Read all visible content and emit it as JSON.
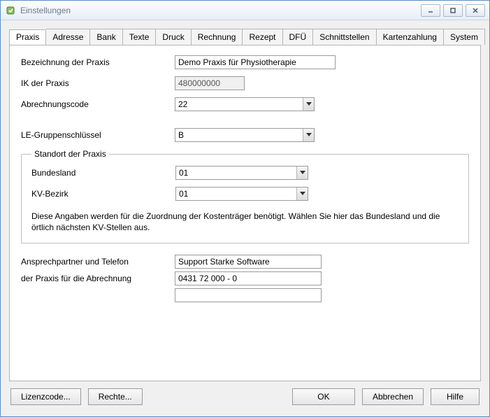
{
  "window": {
    "title": "Einstellungen"
  },
  "winbuttons": {
    "min": "minimize",
    "max": "maximize",
    "close": "close"
  },
  "tabs": [
    {
      "label": "Praxis"
    },
    {
      "label": "Adresse"
    },
    {
      "label": "Bank"
    },
    {
      "label": "Texte"
    },
    {
      "label": "Druck"
    },
    {
      "label": "Rechnung"
    },
    {
      "label": "Rezept"
    },
    {
      "label": "DFÜ"
    },
    {
      "label": "Schnittstellen"
    },
    {
      "label": "Kartenzahlung"
    },
    {
      "label": "System"
    }
  ],
  "form": {
    "bezeichnung_label": "Bezeichnung der Praxis",
    "bezeichnung_value": "Demo Praxis für Physiotherapie",
    "ik_label": "IK der Praxis",
    "ik_value": "480000000",
    "abrechnungscode_label": "Abrechnungscode",
    "abrechnungscode_value": "22",
    "le_label": "LE-Gruppenschlüssel",
    "le_value": "B",
    "standort_legend": "Standort der Praxis",
    "bundesland_label": "Bundesland",
    "bundesland_value": "01",
    "kv_label": "KV-Bezirk",
    "kv_value": "01",
    "info_text": "Diese Angaben werden für die Zuordnung der Kostenträger benötigt. Wählen Sie hier das Bundesland und die örtlich nächsten KV-Stellen aus.",
    "ansprech_label1": "Ansprechpartner und Telefon",
    "ansprech_label2": "der Praxis für die Abrechnung",
    "ansprech_value": "Support Starke Software",
    "tel_value": "0431 72 000 - 0",
    "extra_value": ""
  },
  "buttons": {
    "lizenzcode": "Lizenzcode...",
    "rechte": "Rechte...",
    "ok": "OK",
    "abbrechen": "Abbrechen",
    "hilfe": "Hilfe"
  }
}
